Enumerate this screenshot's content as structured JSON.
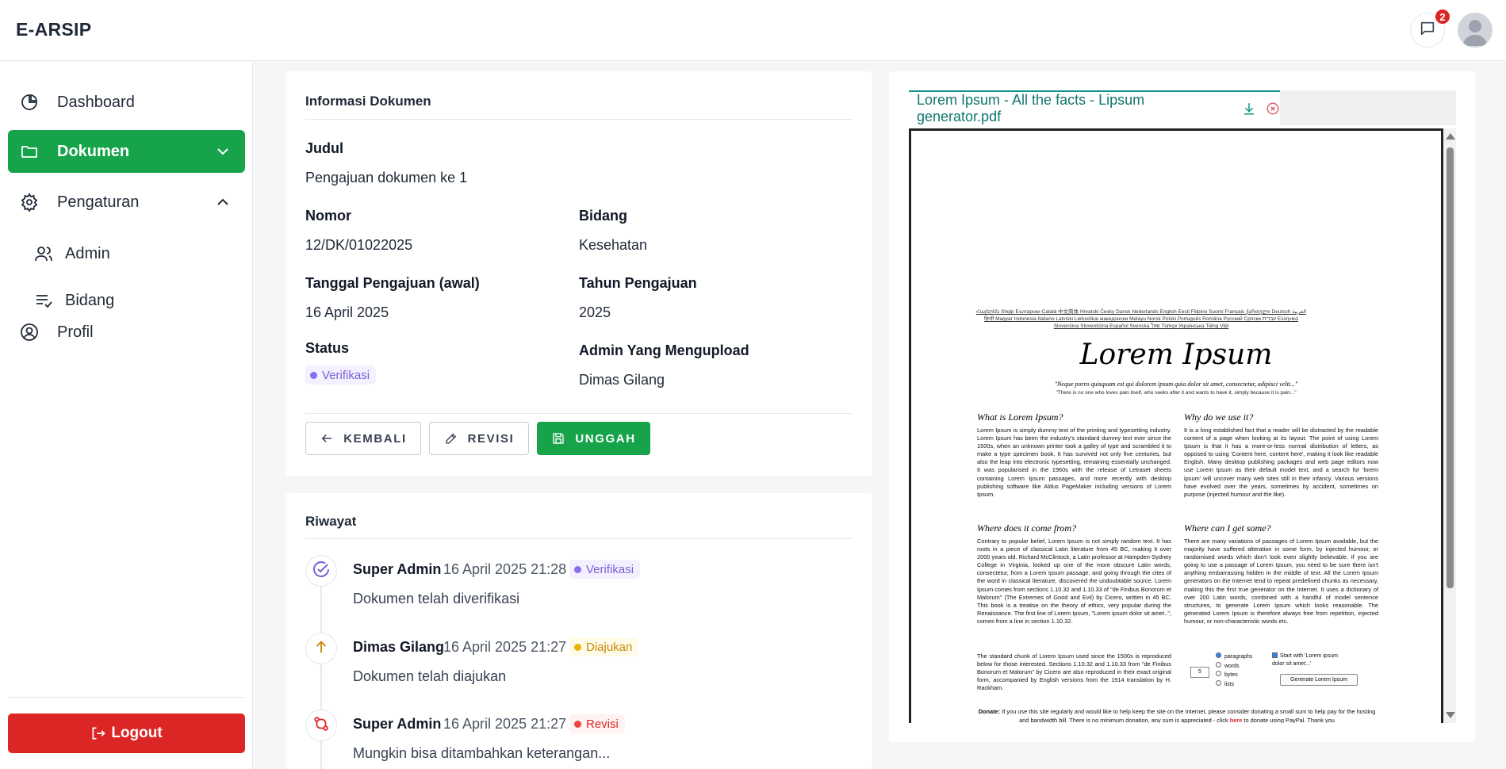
{
  "header": {
    "brand": "E-ARSIP",
    "notification_count": "2"
  },
  "sidebar": {
    "items": [
      {
        "label": "Dashboard"
      },
      {
        "label": "Dokumen"
      },
      {
        "label": "Pengaturan"
      },
      {
        "label": "Admin"
      },
      {
        "label": "Bidang"
      },
      {
        "label": "Profil"
      }
    ],
    "logout_label": "Logout"
  },
  "info": {
    "title": "Informasi Dokumen",
    "judul_label": "Judul",
    "judul_value": "Pengajuan dokumen ke 1",
    "nomor_label": "Nomor",
    "nomor_value": "12/DK/01022025",
    "bidang_label": "Bidang",
    "bidang_value": "Kesehatan",
    "tanggal_label": "Tanggal Pengajuan (awal)",
    "tanggal_value": "16 April 2025",
    "tahun_label": "Tahun Pengajuan",
    "tahun_value": "2025",
    "status_label": "Status",
    "status_value": "Verifikasi",
    "admin_label": "Admin Yang Mengupload",
    "admin_value": "Dimas Gilang",
    "buttons": {
      "back": "KEMBALI",
      "revise": "REVISI",
      "upload": "UNGGAH"
    }
  },
  "history": {
    "title": "Riwayat",
    "entries": [
      {
        "name": "Super Admin",
        "date": "16 April 2025 21:28",
        "status": "Verifikasi",
        "desc": "Dokumen telah diverifikasi",
        "icon": "check-circle-icon",
        "color": "#7c5fd8"
      },
      {
        "name": "Dimas Gilang",
        "date": "16 April 2025 21:27",
        "status": "Diajukan",
        "desc": "Dokumen telah diajukan",
        "icon": "arrow-up-icon",
        "color": "#ca8a04"
      },
      {
        "name": "Super Admin",
        "date": "16 April 2025 21:27",
        "status": "Revisi",
        "desc": "Mungkin bisa ditambahkan keterangan...",
        "icon": "git-compare-icon",
        "color": "#dc2626"
      }
    ]
  },
  "viewer": {
    "tab_label": "Lorem Ipsum - All the facts - Lipsum generator.pdf",
    "pdf": {
      "languages": "Հայերեն Shqip ‫العربية Български Català 中文简体 Hrvatski Česky Dansk Nederlands English Eesti Filipino Suomi Français ქართული Deutsch Ελληνικά ‫עברית हिन्दी Magyar Indonesia Italiano Latviski Lietuviškai македонски Melayu Norsk Polski Português Româna Pyccкий Српски Slovenčina Slovenščina Español Svenska ไทย Türkçe Українська Tiếng Việt",
      "title": "Lorem Ipsum",
      "quote": "\"Neque porro quisquam est qui dolorem ipsum quia dolor sit amet, consectetur, adipisci velit...\"",
      "quote_translation": "\"There is no one who loves pain itself, who seeks after it and wants to have it, simply because it is pain...\"",
      "h1": "What is Lorem Ipsum?",
      "p1": "Lorem Ipsum is simply dummy text of the printing and typesetting industry. Lorem Ipsum has been the industry's standard dummy text ever since the 1500s, when an unknown printer took a galley of type and scrambled it to make a type specimen book. It has survived not only five centuries, but also the leap into electronic typesetting, remaining essentially unchanged. It was popularised in the 1960s with the release of Letraset sheets containing Lorem Ipsum passages, and more recently with desktop publishing software like Aldus PageMaker including versions of Lorem Ipsum.",
      "h2": "Why do we use it?",
      "p2": "It is a long established fact that a reader will be distracted by the readable content of a page when looking at its layout. The point of using Lorem Ipsum is that it has a more-or-less normal distribution of letters, as opposed to using 'Content here, content here', making it look like readable English. Many desktop publishing packages and web page editors now use Lorem Ipsum as their default model text, and a search for 'lorem ipsum' will uncover many web sites still in their infancy. Various versions have evolved over the years, sometimes by accident, sometimes on purpose (injected humour and the like).",
      "h3": "Where does it come from?",
      "p3": "Contrary to popular belief, Lorem Ipsum is not simply random text. It has roots in a piece of classical Latin literature from 45 BC, making it over 2000 years old. Richard McClintock, a Latin professor at Hampden-Sydney College in Virginia, looked up one of the more obscure Latin words, consectetur, from a Lorem Ipsum passage, and going through the cites of the word in classical literature, discovered the undoubtable source. Lorem Ipsum comes from sections 1.10.32 and 1.10.33 of \"de Finibus Bonorum et Malorum\" (The Extremes of Good and Evil) by Cicero, written in 45 BC. This book is a treatise on the theory of ethics, very popular during the Renaissance. The first line of Lorem Ipsum, \"Lorem ipsum dolor sit amet..\", comes from a line in section 1.10.32.",
      "p3b": "The standard chunk of Lorem Ipsum used since the 1500s is reproduced below for those interested. Sections 1.10.32 and 1.10.33 from \"de Finibus Bonorum et Malorum\" by Cicero are also reproduced in their exact original form, accompanied by English versions from the 1914 translation by H. Rackham.",
      "h4": "Where can I get some?",
      "p4": "There are many variations of passages of Lorem Ipsum available, but the majority have suffered alteration in some form, by injected humour, or randomised words which don't look even slightly believable. If you are going to use a passage of Lorem Ipsum, you need to be sure there isn't anything embarrassing hidden in the middle of text. All the Lorem Ipsum generators on the Internet tend to repeat predefined chunks as necessary, making this the first true generator on the Internet. It uses a dictionary of over 200 Latin words, combined with a handful of model sentence structures, to generate Lorem Ipsum which looks reasonable. The generated Lorem Ipsum is therefore always free from repetition, injected humour, or non-characteristic words etc.",
      "form_amount": "5",
      "form_options": [
        "paragraphs",
        "words",
        "bytes",
        "lists"
      ],
      "form_start": "Start with 'Lorem ipsum dolor sit amet...'",
      "form_button": "Generate Lorem Ipsum",
      "donate_label": "Donate:",
      "donate_text": "If you use this site regularly and would like to help keep the site on the Internet, please consider donating a small sum to help pay for the hosting and bandwidth bill. There is no minimum donation, any sum is appreciated - click",
      "donate_link": "here",
      "donate_tail": "to donate using PayPal. Thank you"
    }
  }
}
